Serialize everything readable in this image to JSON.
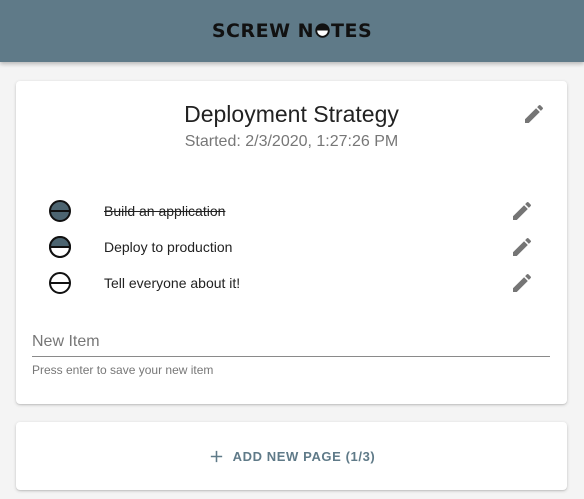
{
  "app": {
    "logo_left": "SCREW N",
    "logo_right": "TES"
  },
  "note": {
    "title": "Deployment Strategy",
    "started": "Started: 2/3/2020, 1:27:26 PM"
  },
  "items": [
    {
      "label": "Build an application",
      "status": "done",
      "status_icon": "full-circle-icon"
    },
    {
      "label": "Deploy to production",
      "status": "half",
      "status_icon": "half-circle-icon"
    },
    {
      "label": "Tell everyone about it!",
      "status": "empty",
      "status_icon": "empty-circle-icon"
    }
  ],
  "new_item": {
    "placeholder": "New Item",
    "value": "",
    "hint": "Press enter to save your new item"
  },
  "add_page": {
    "label": "ADD NEW PAGE (1/3)"
  },
  "colors": {
    "header": "#5f7a88",
    "accent": "#5f7a88",
    "circle_fill": "#4c6470"
  }
}
